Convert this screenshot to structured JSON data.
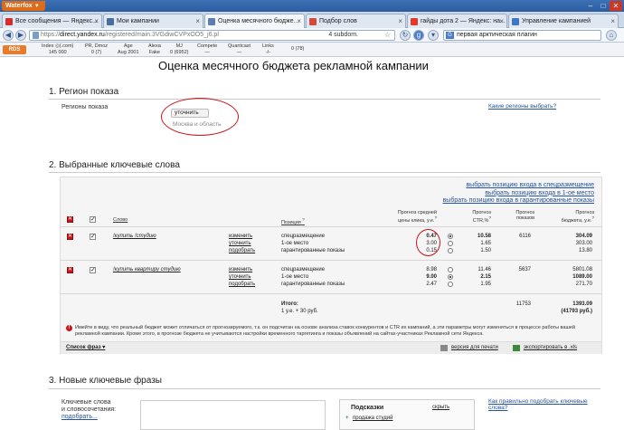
{
  "browser": {
    "app_name": "Waterfox",
    "tabs": [
      {
        "label": "Все сообщения — Яндекс...",
        "color": "#d12f2f"
      },
      {
        "label": "Мои кампании",
        "color": "#4c6e9c"
      },
      {
        "label": "Оценка месячного бюдже...",
        "color": "#5e7fae",
        "active": true
      },
      {
        "label": "Подбор слов",
        "color": "#d44a3a"
      },
      {
        "label": "гайды дота 2 — Яндекс: на...",
        "color": "#e03a2a"
      },
      {
        "label": "Управление кампанией",
        "color": "#3f77c2"
      }
    ],
    "url_prefix": "https://",
    "url_host": "direct.yandex.ru",
    "url_path": "/registered/main.3VGdiwCVPxOO5_j6.pl",
    "subdomains": "4 subdom.",
    "search_value": "первая арктическая плагин"
  },
  "rds": {
    "logo": "RDS",
    "cells": [
      {
        "title": "Index ◎(.com)",
        "value": "145 000"
      },
      {
        "title": "PR, Dmoz",
        "value": "0  (7)"
      },
      {
        "title": "Age",
        "value": "Aug 2001"
      },
      {
        "title": "Alexa",
        "value": "Fake"
      },
      {
        "title": "MJ",
        "value": "0 (6952)"
      },
      {
        "title": "Compete",
        "value": "—"
      },
      {
        "title": "Quantcast",
        "value": "—"
      },
      {
        "title": "Links",
        "value": "-/-"
      },
      {
        "title": "",
        "value": "0  (78)"
      }
    ]
  },
  "page": {
    "title": "Оценка месячного бюджета рекламной кампании",
    "region": {
      "section_title": "1. Регион показа",
      "label": "Регионы показа",
      "refine_button": "уточнить",
      "region_value": "Москва и область",
      "help_link": "Какие регионы выбрать?"
    },
    "keywords": {
      "section_title": "2. Выбранные ключевые слова",
      "position_links": [
        "выбрать позицию входа в спецразмещение",
        "выбрать позицию входа в 1-ое место",
        "выбрать позицию входа в гарантированные показы"
      ],
      "headers": {
        "word": "Слово",
        "position": "Позиция",
        "position_sup": "?",
        "price_1": "Прогноз средней",
        "price_2": "цены клика, у.е.",
        "price_sup": "?",
        "ctr_1": "Прогноз",
        "ctr_2": "CTR,%",
        "ctr_sup": "?",
        "shows_1": "Прогноз",
        "shows_2": "показов",
        "budget_1": "Прогноз",
        "budget_2": "бюджета, у.е.",
        "budget_sup": "?"
      },
      "rows": [
        {
          "phrase": "!купить !студию",
          "actions": [
            "изменить",
            "уточнить",
            "подобрать"
          ],
          "positions": [
            "спецразмещение",
            "1-ое место",
            "гарантированные показы"
          ],
          "prices": [
            "0.47",
            "3.00",
            "0.15"
          ],
          "ctr": [
            "10.58",
            "1.65",
            "1.50"
          ],
          "shows": "6116",
          "budgets": [
            "304.09",
            "303.00",
            "13.80"
          ],
          "selected": 0
        },
        {
          "phrase": "!купить квартиру студию",
          "actions": [
            "изменить",
            "уточнить",
            "подобрать"
          ],
          "positions": [
            "спецразмещение",
            "1-ое место",
            "гарантированные показы"
          ],
          "prices": [
            "8.98",
            "9.00",
            "2.47"
          ],
          "ctr": [
            "11.46",
            "2.15",
            "1.95"
          ],
          "shows": "5637",
          "budgets": [
            "5801.08",
            "1089.00",
            "271.70"
          ],
          "selected": 1
        }
      ],
      "total_label": "Итого:",
      "total_sub": "1 у.е. + 30 руб.",
      "total_shows": "11753",
      "total_budget": "1393.09",
      "total_budget_rub": "(41793 руб.)",
      "warning": "Имейте в виду, что реальный бюджет может отличаться от прогнозируемого, т.к. он подсчитан на основе анализа ставок конкурентов и CTR их кампаний, а эти параметры могут изменяться в процессе работы вашей рекламной кампании. Кроме этого, в прогнозе бюджета не учитываются настройки временного таргетинга и показы объявлений на сайтах-участниках Рекламной сети Яндекса.",
      "phrase_list": "Список фраз",
      "print_version": "версия для печати",
      "export": "экспортировать в .xls"
    },
    "new_keywords": {
      "section_title": "3. Новые ключевые фразы",
      "label_1": "Ключевые слова",
      "label_2": "и словосочетания:",
      "pick_link": "подобрать...",
      "hints_title": "Подсказки",
      "hints_hide": "скрыть",
      "hint_item": "продажа студий",
      "help_link_1": "Как правильно подобрать ключевые",
      "help_link_2": "слова?"
    }
  }
}
